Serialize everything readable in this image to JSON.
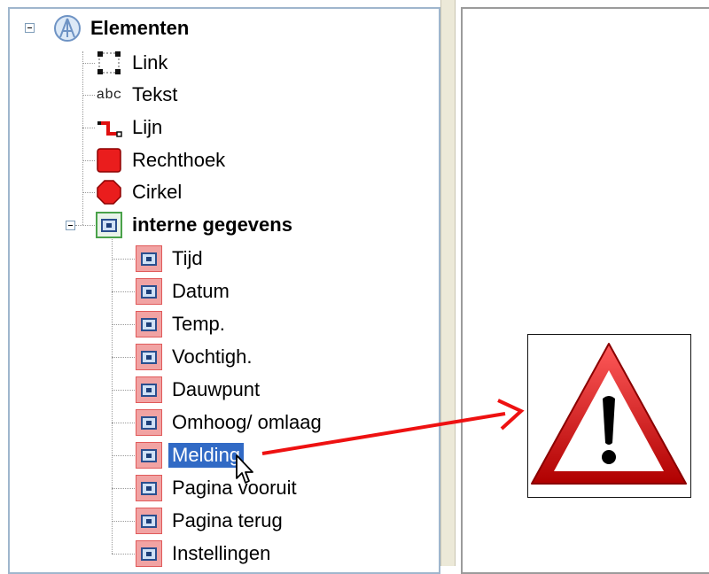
{
  "tree": {
    "root_label": "Elementen",
    "items": [
      {
        "label": "Link",
        "icon": "link-frame-icon"
      },
      {
        "label": "Tekst",
        "icon": "text-abc-icon",
        "icon_text": "abc"
      },
      {
        "label": "Lijn",
        "icon": "line-icon"
      },
      {
        "label": "Rechthoek",
        "icon": "rectangle-icon"
      },
      {
        "label": "Cirkel",
        "icon": "circle-icon"
      }
    ],
    "group": {
      "label": "interne gegevens",
      "icon": "data-icon",
      "items": [
        {
          "label": "Tijd"
        },
        {
          "label": "Datum"
        },
        {
          "label": "Temp."
        },
        {
          "label": "Vochtigh."
        },
        {
          "label": "Dauwpunt"
        },
        {
          "label": "Omhoog/ omlaag"
        },
        {
          "label": "Melding",
          "selected": true
        },
        {
          "label": "Pagina vooruit"
        },
        {
          "label": "Pagina terug"
        },
        {
          "label": "Instellingen"
        }
      ]
    }
  },
  "colors": {
    "selection": "#316ac5",
    "data_icon_fill": "#f1a3a3",
    "warning_red": "#cc0000",
    "arrow_red": "#ee1111"
  },
  "canvas": {
    "preview_icon": "warning-triangle-icon"
  }
}
